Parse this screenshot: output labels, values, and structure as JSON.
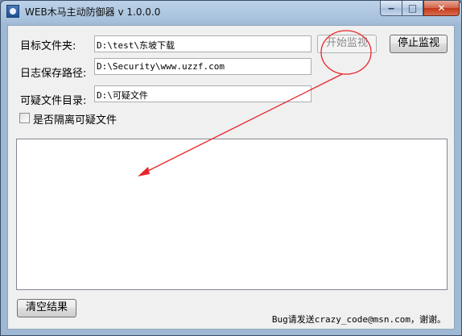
{
  "window": {
    "title": "WEB木马主动防御器 v 1.0.0.0",
    "controls": {
      "minimize": "‒",
      "maximize": "□",
      "close": "✕"
    }
  },
  "form": {
    "target_folder_label": "目标文件夹:",
    "target_folder_value": "D:\\test\\东坡下载",
    "log_path_label": "日志保存路径:",
    "log_path_value": "D:\\Security\\www.uzzf.com",
    "suspicious_dir_label": "可疑文件目录:",
    "suspicious_dir_value": "D:\\可疑文件",
    "isolate_label": "是否隔离可疑文件",
    "isolate_checked": false
  },
  "buttons": {
    "start": "开始监视",
    "stop": "停止监视",
    "clear": "清空结果"
  },
  "footer": {
    "contact": "Bug请发送crazy_code@msn.com，谢谢。"
  },
  "annotation": {
    "color": "#e8262a"
  }
}
